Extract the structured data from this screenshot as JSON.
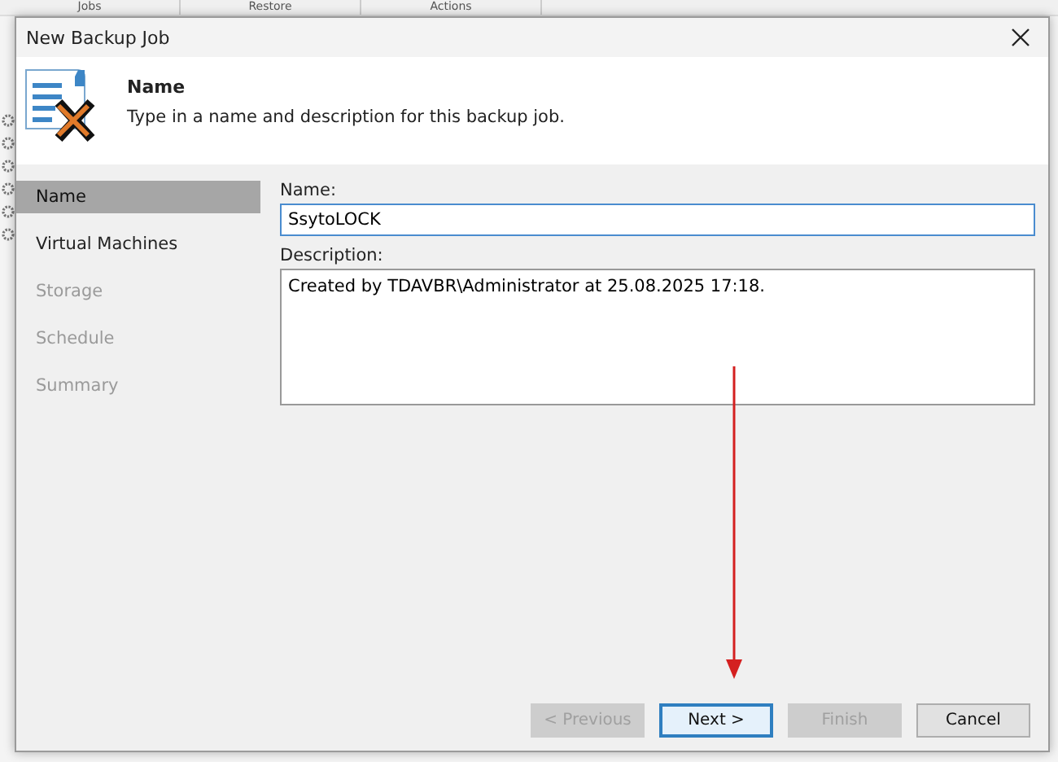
{
  "background": {
    "menu_tabs": [
      "Jobs",
      "Restore",
      "Actions"
    ]
  },
  "dialog": {
    "title": "New Backup Job",
    "header": {
      "title": "Name",
      "subtitle": "Type in a name and description for this backup job."
    },
    "steps": [
      {
        "label": "Name",
        "selected": true,
        "disabled": false
      },
      {
        "label": "Virtual Machines",
        "selected": false,
        "disabled": false
      },
      {
        "label": "Storage",
        "selected": false,
        "disabled": true
      },
      {
        "label": "Schedule",
        "selected": false,
        "disabled": true
      },
      {
        "label": "Summary",
        "selected": false,
        "disabled": true
      }
    ],
    "name_field": {
      "label": "Name:",
      "value": "SsytoLOCK"
    },
    "description_field": {
      "label": "Description:",
      "value": "Created by TDAVBR\\Administrator at 25.08.2025 17:18."
    },
    "buttons": [
      {
        "label": "< Previous",
        "disabled": true,
        "focused": false
      },
      {
        "label": "Next >",
        "disabled": false,
        "focused": true
      },
      {
        "label": "Finish",
        "disabled": true,
        "focused": false
      },
      {
        "label": "Cancel",
        "disabled": false,
        "focused": false
      }
    ]
  },
  "annotation": {
    "kind": "arrow"
  }
}
